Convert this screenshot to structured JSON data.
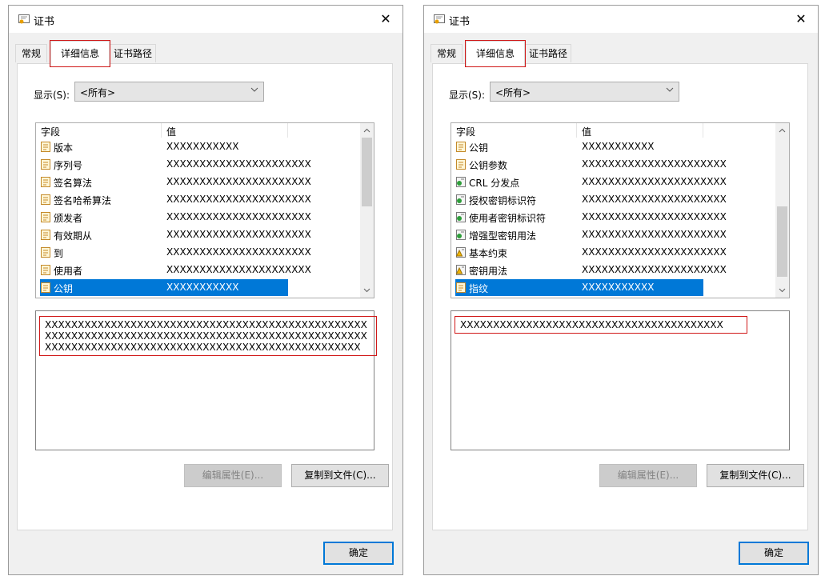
{
  "dialogs": [
    {
      "title": "证书",
      "close_glyph": "✕",
      "tabs": [
        "常规",
        "详细信息",
        "证书路径"
      ],
      "active_tab": "详细信息",
      "show_label": "显示(S):",
      "show_value": "<所有>",
      "columns": {
        "field": "字段",
        "value": "值"
      },
      "rows": [
        {
          "field": "版本",
          "value": "XXXXXXXXXXX",
          "icon": "document-icon"
        },
        {
          "field": "序列号",
          "value": "XXXXXXXXXXXXXXXXXXXXXX",
          "icon": "document-icon"
        },
        {
          "field": "签名算法",
          "value": "XXXXXXXXXXXXXXXXXXXXXX",
          "icon": "document-icon"
        },
        {
          "field": "签名哈希算法",
          "value": "XXXXXXXXXXXXXXXXXXXXXX",
          "icon": "document-icon"
        },
        {
          "field": "颁发者",
          "value": "XXXXXXXXXXXXXXXXXXXXXX",
          "icon": "document-icon"
        },
        {
          "field": "有效期从",
          "value": "XXXXXXXXXXXXXXXXXXXXXX",
          "icon": "document-icon"
        },
        {
          "field": "到",
          "value": "XXXXXXXXXXXXXXXXXXXXXX",
          "icon": "document-icon"
        },
        {
          "field": "使用者",
          "value": "XXXXXXXXXXXXXXXXXXXXXX",
          "icon": "document-icon"
        },
        {
          "field": "公钥",
          "value": "XXXXXXXXXXX",
          "icon": "document-icon",
          "selected": true
        }
      ],
      "detail_text": "XXXXXXXXXXXXXXXXXXXXXXXXXXXXXXXXXXXXXXXXXXXXXXXXXXXXXXXXXXXXXXXXXXXXXXXXXXXXXXXXXXXXXXXXXXXXXXXXXXXXXXXXXXXXXXXXXXXXXXXXXXXXXXXXXXXXXXXXXXXXXXXXXX",
      "edit_button": "编辑属性(E)...",
      "copy_button": "复制到文件(C)...",
      "ok_button": "确定"
    },
    {
      "title": "证书",
      "close_glyph": "✕",
      "tabs": [
        "常规",
        "详细信息",
        "证书路径"
      ],
      "active_tab": "详细信息",
      "show_label": "显示(S):",
      "show_value": "<所有>",
      "columns": {
        "field": "字段",
        "value": "值"
      },
      "rows": [
        {
          "field": "公钥",
          "value": "XXXXXXXXXXX",
          "icon": "document-icon"
        },
        {
          "field": "公钥参数",
          "value": "XXXXXXXXXXXXXXXXXXXXXX",
          "icon": "document-icon"
        },
        {
          "field": "CRL 分发点",
          "value": "XXXXXXXXXXXXXXXXXXXXXX",
          "icon": "extension-icon"
        },
        {
          "field": "授权密钥标识符",
          "value": "XXXXXXXXXXXXXXXXXXXXXX",
          "icon": "extension-icon"
        },
        {
          "field": "使用者密钥标识符",
          "value": "XXXXXXXXXXXXXXXXXXXXXX",
          "icon": "extension-icon"
        },
        {
          "field": "增强型密钥用法",
          "value": "XXXXXXXXXXXXXXXXXXXXXX",
          "icon": "extension-icon"
        },
        {
          "field": "基本约束",
          "value": "XXXXXXXXXXXXXXXXXXXXXX",
          "icon": "critical-extension-icon"
        },
        {
          "field": "密钥用法",
          "value": "XXXXXXXXXXXXXXXXXXXXXX",
          "icon": "critical-extension-icon"
        },
        {
          "field": "指纹",
          "value": "XXXXXXXXXXX",
          "icon": "document-icon",
          "selected": true
        }
      ],
      "detail_text": "XXXXXXXXXXXXXXXXXXXXXXXXXXXXXXXXXXXXXXXX",
      "edit_button": "编辑属性(E)...",
      "copy_button": "复制到文件(C)...",
      "ok_button": "确定"
    }
  ],
  "colors": {
    "selection": "#0078d7",
    "highlight_box": "#d01818",
    "dialog_bg": "#f0f0f0"
  }
}
